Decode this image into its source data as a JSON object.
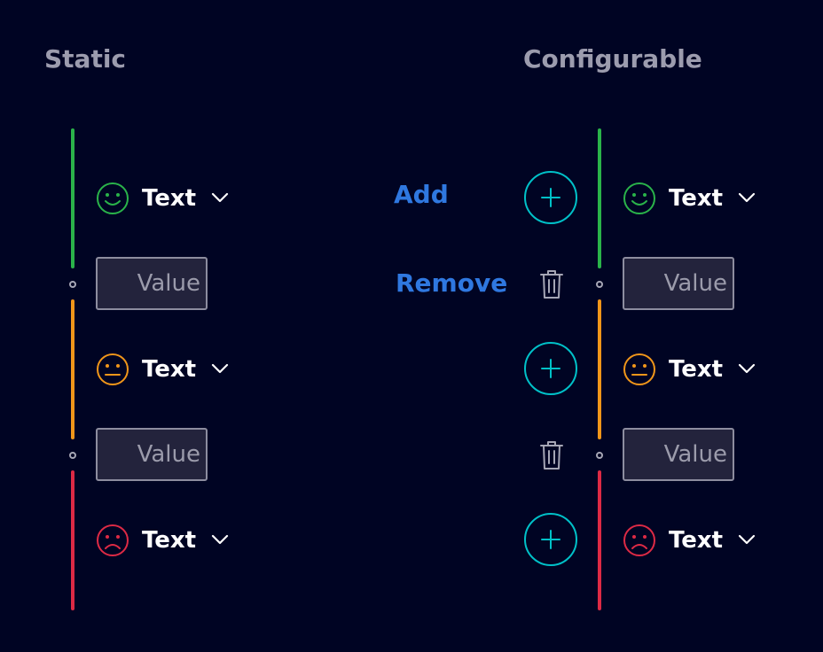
{
  "headings": {
    "static": "Static",
    "configurable": "Configurable"
  },
  "annotations": {
    "add": "Add",
    "remove": "Remove"
  },
  "colors": {
    "good": "#2ab34a",
    "warn": "#f0961a",
    "bad": "#dd2a45",
    "accent": "#00c1c8",
    "annotation": "#2f78e0"
  },
  "rows": [
    {
      "label": "Text",
      "status": "good",
      "icon": "smile-icon"
    },
    {
      "label": "Text",
      "status": "warn",
      "icon": "neutral-face-icon"
    },
    {
      "label": "Text",
      "status": "bad",
      "icon": "frown-icon"
    }
  ],
  "thresholds": [
    {
      "placeholder": "Value"
    },
    {
      "placeholder": "Value"
    }
  ]
}
